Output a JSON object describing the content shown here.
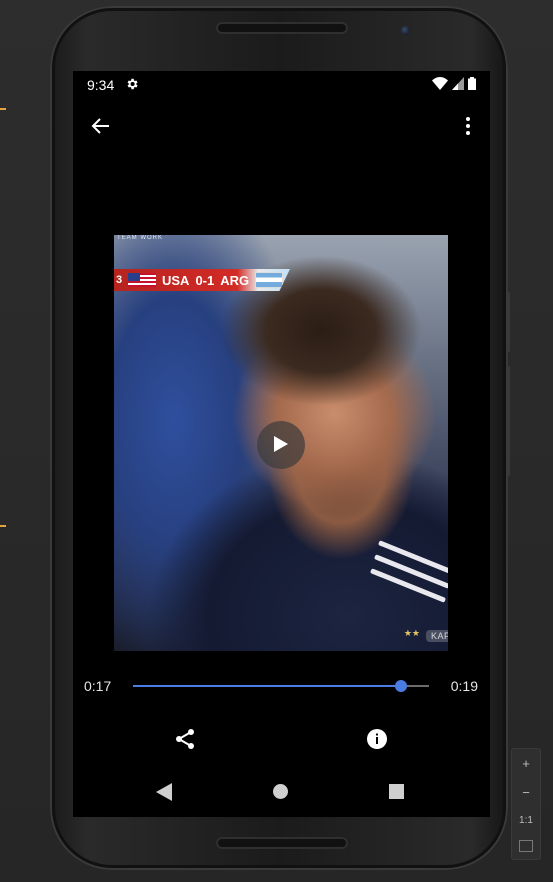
{
  "status_bar": {
    "time": "9:34",
    "settings_icon": "gear-icon",
    "wifi_icon": "wifi-icon",
    "signal_icon": "signal-icon",
    "battery_icon": "battery-icon"
  },
  "toolbar": {
    "back_icon": "arrow-back-icon",
    "more_icon": "more-vert-icon"
  },
  "video": {
    "scoreboard": {
      "clock": "3",
      "home": "USA",
      "score": "0-1",
      "away": "ARG"
    },
    "channel_brand": "TEAM WORK",
    "watermark": "KAPWING",
    "stars": "★★",
    "play_icon": "play-icon"
  },
  "player": {
    "current_time": "0:17",
    "total_time": "0:19",
    "progress_fraction": 0.905,
    "accent_color": "#4a7ce3"
  },
  "actions": {
    "share_icon": "share-icon",
    "info_icon": "info-icon"
  },
  "nav_bar": {
    "back_icon": "nav-back-icon",
    "home_icon": "nav-home-icon",
    "recents_icon": "nav-recents-icon"
  },
  "emulator_controls": {
    "zoom_in": "+",
    "zoom_out": "−",
    "actual_size": "1:1"
  }
}
